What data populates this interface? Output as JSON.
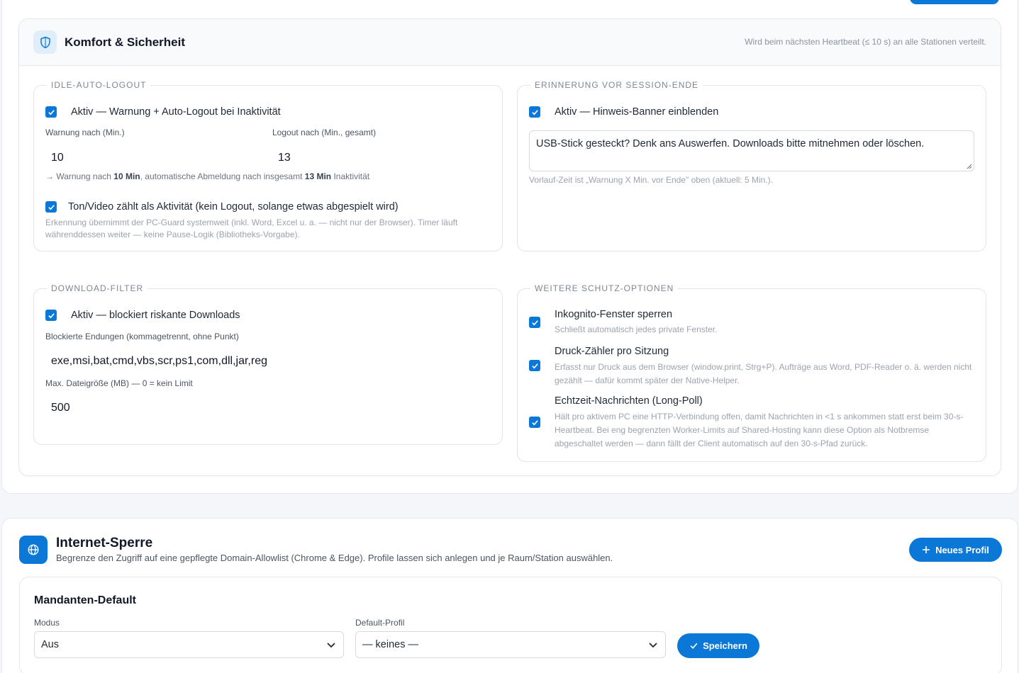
{
  "komfort": {
    "title": "Komfort & Sicherheit",
    "note": "Wird beim nächsten Heartbeat (≤ 10 s) an alle Stationen verteilt.",
    "shield_icon": "shield-icon",
    "idle": {
      "legend": "IDLE-AUTO-LOGOUT",
      "active_label": "Aktiv — Warnung + Auto-Logout bei Inaktivität",
      "active_checked": true,
      "warn_label": "Warnung nach (Min.)",
      "warn_value": "10",
      "logout_label": "Logout nach (Min., gesamt)",
      "logout_value": "13",
      "summary_prefix": "→ Warnung nach ",
      "summary_warn": "10 Min",
      "summary_mid": ", automatische Abmeldung nach insgesamt ",
      "summary_logout": "13 Min",
      "summary_suffix": " Inaktivität",
      "media_label": "Ton/Video zählt als Aktivität (kein Logout, solange etwas abgespielt wird)",
      "media_checked": true,
      "media_hint": "Erkennung übernimmt der PC-Guard systemweit (inkl. Word, Excel u. a. — nicht nur der Browser). Timer läuft währenddessen weiter — keine Pause-Logik (Bibliotheks-Vorgabe)."
    },
    "reminder": {
      "legend": "ERINNERUNG VOR SESSION-ENDE",
      "active_label": "Aktiv — Hinweis-Banner einblenden",
      "active_checked": true,
      "message": "USB-Stick gesteckt? Denk ans Auswerfen. Downloads bitte mitnehmen oder löschen.",
      "hint": "Vorlauf-Zeit ist „Warnung X Min. vor Ende\" oben (aktuell: 5 Min.)."
    },
    "download": {
      "legend": "DOWNLOAD-FILTER",
      "active_label": "Aktiv — blockiert riskante Downloads",
      "active_checked": true,
      "ext_label": "Blockierte Endungen (kommagetrennt, ohne Punkt)",
      "ext_value": "exe,msi,bat,cmd,vbs,scr,ps1,com,dll,jar,reg",
      "size_label": "Max. Dateigröße (MB) — 0 = kein Limit",
      "size_value": "500"
    },
    "more": {
      "legend": "WEITERE SCHUTZ-OPTIONEN",
      "options": [
        {
          "label": "Inkognito-Fenster sperren",
          "hint": "Schließt automatisch jedes private Fenster.",
          "checked": true
        },
        {
          "label": "Druck-Zähler pro Sitzung",
          "hint": "Erfasst nur Druck aus dem Browser (window.print, Strg+P). Aufträge aus Word, PDF-Reader o. ä. werden nicht gezählt — dafür kommt später der Native-Helper.",
          "checked": true
        },
        {
          "label": "Echtzeit-Nachrichten (Long-Poll)",
          "hint": "Hält pro aktivem PC eine HTTP-Verbindung offen, damit Nachrichten in <1 s ankommen statt erst beim 30-s-Heartbeat. Bei eng begrenzten Worker-Limits auf Shared-Hosting kann diese Option als Notbremse abgeschaltet werden — dann fällt der Client automatisch auf den 30-s-Pfad zurück.",
          "checked": true
        }
      ]
    }
  },
  "internet": {
    "title": "Internet-Sperre",
    "subtitle": "Begrenze den Zugriff auf eine gepflegte Domain-Allowlist (Chrome & Edge). Profile lassen sich anlegen und je Raum/Station auswählen.",
    "new_profile_label": "Neues Profil",
    "globe_icon": "globe-icon",
    "mandant": {
      "title": "Mandanten-Default",
      "mode_label": "Modus",
      "mode_value": "Aus",
      "profile_label": "Default-Profil",
      "profile_value": "— keines —",
      "save_label": "Speichern"
    }
  },
  "colors": {
    "accent": "#0b78d7",
    "border": "#e1e5eb",
    "muted": "#9ca3af"
  }
}
